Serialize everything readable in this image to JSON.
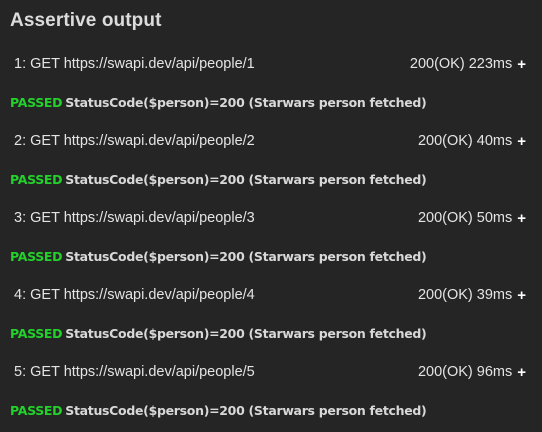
{
  "title": "Assertive output",
  "colors": {
    "background": "#252526",
    "passed": "#22d12a",
    "text": "#e4e4e4"
  },
  "entries": [
    {
      "request": "1: GET https://swapi.dev/api/people/1",
      "status": "200(OK) 223ms",
      "expand": "+",
      "result": "PASSED",
      "assertion": "StatusCode($person)=200 (Starwars person fetched)"
    },
    {
      "request": "2: GET https://swapi.dev/api/people/2",
      "status": "200(OK) 40ms",
      "expand": "+",
      "result": "PASSED",
      "assertion": "StatusCode($person)=200 (Starwars person fetched)"
    },
    {
      "request": "3: GET https://swapi.dev/api/people/3",
      "status": "200(OK) 50ms",
      "expand": "+",
      "result": "PASSED",
      "assertion": "StatusCode($person)=200 (Starwars person fetched)"
    },
    {
      "request": "4: GET https://swapi.dev/api/people/4",
      "status": "200(OK) 39ms",
      "expand": "+",
      "result": "PASSED",
      "assertion": "StatusCode($person)=200 (Starwars person fetched)"
    },
    {
      "request": "5: GET https://swapi.dev/api/people/5",
      "status": "200(OK) 96ms",
      "expand": "+",
      "result": "PASSED",
      "assertion": "StatusCode($person)=200 (Starwars person fetched)"
    }
  ]
}
